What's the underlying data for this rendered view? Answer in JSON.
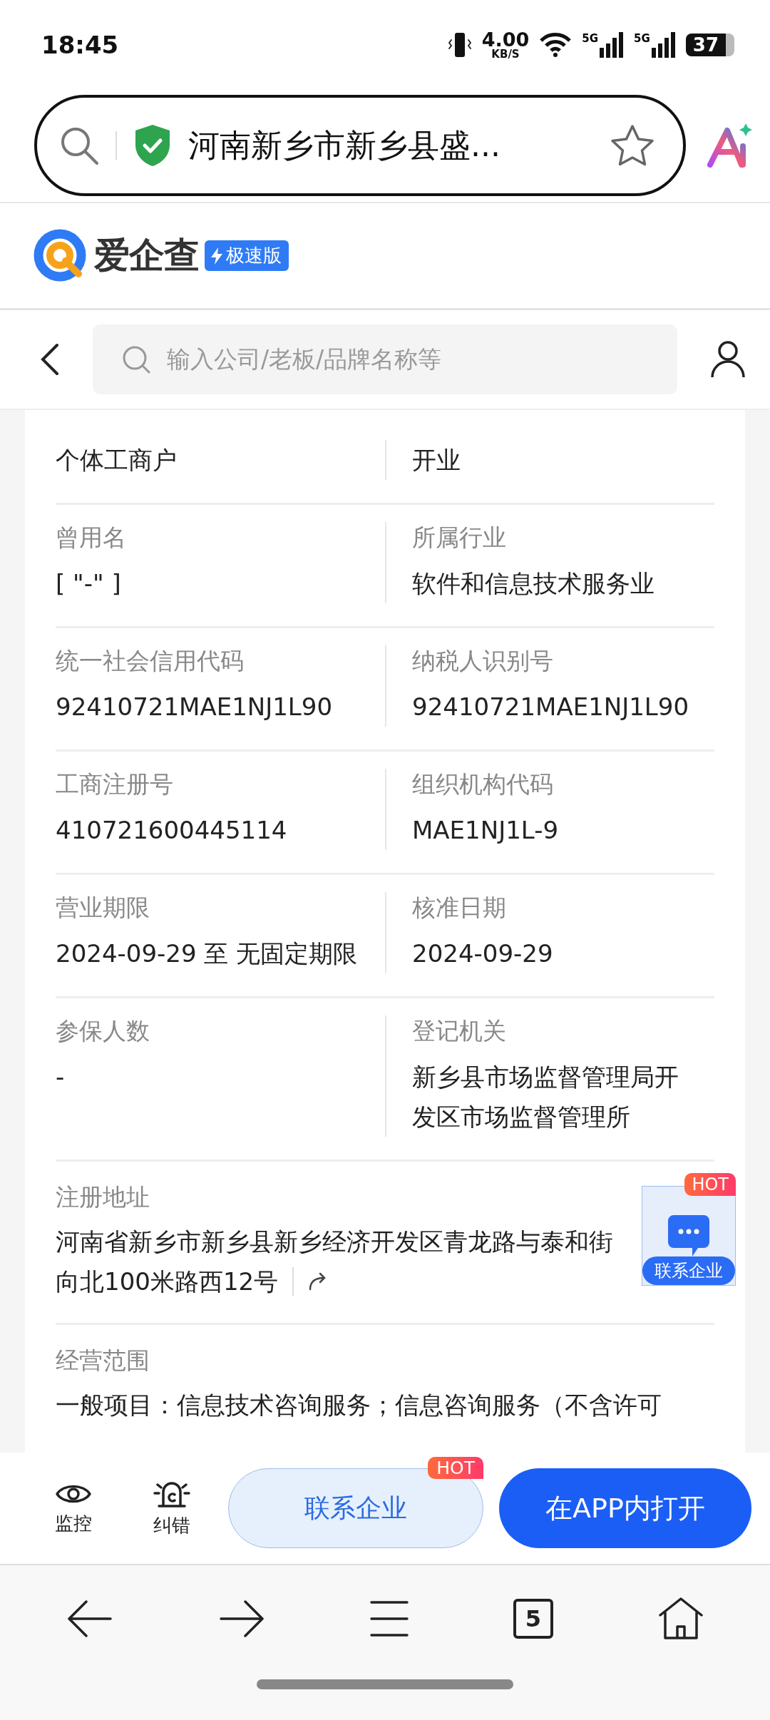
{
  "status_bar": {
    "time": "18:45",
    "speed": "4.00",
    "speed_unit": "KB/S",
    "network_1": "5G",
    "network_2": "5G",
    "battery": "37"
  },
  "browser_bar": {
    "url_title": "河南新乡市新乡县盛..."
  },
  "brand": {
    "name": "爱企查",
    "badge": "极速版"
  },
  "header": {
    "search_placeholder": "输入公司/老板/品牌名称等"
  },
  "info_rows": [
    {
      "cells": [
        {
          "value_lines": [
            "个体工商户"
          ]
        },
        {
          "value_lines": [
            "开业"
          ]
        }
      ]
    },
    {
      "cells": [
        {
          "label": "曾用名",
          "value_lines": [
            "[ \"-\" ]"
          ]
        },
        {
          "label": "所属行业",
          "value_lines": [
            "软件和信息技术服务业"
          ]
        }
      ]
    },
    {
      "cells": [
        {
          "label": "统一社会信用代码",
          "value_lines": [
            "92410721MAE1NJ1L90"
          ]
        },
        {
          "label": "纳税人识别号",
          "value_lines": [
            "92410721MAE1NJ1L90"
          ]
        }
      ]
    },
    {
      "cells": [
        {
          "label": "工商注册号",
          "value_lines": [
            "410721600445114"
          ]
        },
        {
          "label": "组织机构代码",
          "value_lines": [
            "MAE1NJ1L-9"
          ]
        }
      ]
    },
    {
      "cells": [
        {
          "label": "营业期限",
          "value_lines": [
            "2024-09-29 至 无固定期限"
          ]
        },
        {
          "label": "核准日期",
          "value_lines": [
            "2024-09-29"
          ]
        }
      ]
    },
    {
      "cells": [
        {
          "label": "参保人数",
          "value_lines": [
            "-"
          ]
        },
        {
          "label": "登记机关",
          "value_lines": [
            "新乡县市场监督管理局开",
            "发区市场监督管理所"
          ]
        }
      ]
    }
  ],
  "address": {
    "label": "注册地址",
    "lines": [
      "河南省新乡市新乡县新乡经济开发区青龙路与泰和街",
      "向北100米路西12号"
    ]
  },
  "scope": {
    "label": "经营范围",
    "text": "一般项目：信息技术咨询服务；信息咨询服务（不含许可"
  },
  "float_button": {
    "badge": "HOT",
    "label": "联系企业"
  },
  "action_bar": {
    "tools": [
      {
        "kind": "eye",
        "label": "监控"
      },
      {
        "kind": "alarm",
        "label": "纠错"
      }
    ],
    "contact_button": {
      "label": "联系企业",
      "badge": "HOT"
    },
    "open_button": {
      "label": "在APP内打开"
    }
  },
  "nav_bar": {
    "tab_count": "5"
  }
}
